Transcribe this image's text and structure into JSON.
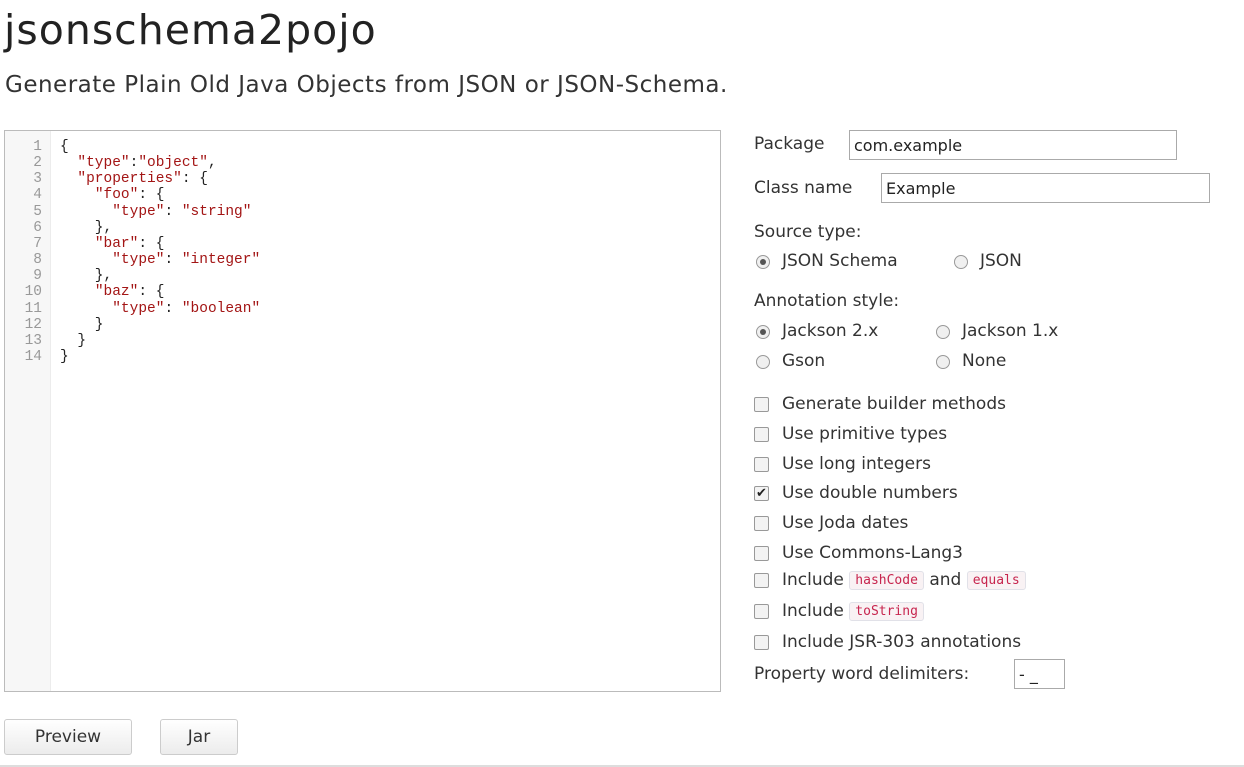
{
  "header": {
    "title": "jsonschema2pojo",
    "subtitle": "Generate Plain Old Java Objects from JSON or JSON-Schema."
  },
  "editor": {
    "lines": [
      {
        "num": "1",
        "code": "{"
      },
      {
        "num": "2",
        "code": "  \"type\":\"object\","
      },
      {
        "num": "3",
        "code": "  \"properties\": {"
      },
      {
        "num": "4",
        "code": "    \"foo\": {"
      },
      {
        "num": "5",
        "code": "      \"type\": \"string\""
      },
      {
        "num": "6",
        "code": "    },"
      },
      {
        "num": "7",
        "code": "    \"bar\": {"
      },
      {
        "num": "8",
        "code": "      \"type\": \"integer\""
      },
      {
        "num": "9",
        "code": "    },"
      },
      {
        "num": "10",
        "code": "    \"baz\": {"
      },
      {
        "num": "11",
        "code": "      \"type\": \"boolean\""
      },
      {
        "num": "12",
        "code": "    }"
      },
      {
        "num": "13",
        "code": "  }"
      },
      {
        "num": "14",
        "code": "}"
      }
    ]
  },
  "form": {
    "package_label": "Package",
    "package_value": "com.example",
    "classname_label": "Class name",
    "classname_value": "Example",
    "source_type_label": "Source type:",
    "source_types": [
      {
        "label": "JSON Schema",
        "selected": true
      },
      {
        "label": "JSON",
        "selected": false
      }
    ],
    "annotation_label": "Annotation style:",
    "annotation_styles": [
      {
        "label": "Jackson 2.x",
        "selected": true
      },
      {
        "label": "Jackson 1.x",
        "selected": false
      },
      {
        "label": "Gson",
        "selected": false
      },
      {
        "label": "None",
        "selected": false
      }
    ],
    "options": [
      {
        "label": "Generate builder methods",
        "checked": false
      },
      {
        "label": "Use primitive types",
        "checked": false
      },
      {
        "label": "Use long integers",
        "checked": false
      },
      {
        "label": "Use double numbers",
        "checked": true
      },
      {
        "label": "Use Joda dates",
        "checked": false
      },
      {
        "label": "Use Commons-Lang3",
        "checked": false
      }
    ],
    "include_hash": {
      "prefix": "Include",
      "code1": "hashCode",
      "middle": "and",
      "code2": "equals",
      "checked": false
    },
    "include_tostring": {
      "prefix": "Include",
      "code": "toString",
      "checked": false
    },
    "include_jsr": {
      "label": "Include JSR-303 annotations",
      "checked": false
    },
    "delimiters_label": "Property word delimiters:",
    "delimiters_value": "- _"
  },
  "buttons": {
    "preview": "Preview",
    "jar": "Jar"
  }
}
